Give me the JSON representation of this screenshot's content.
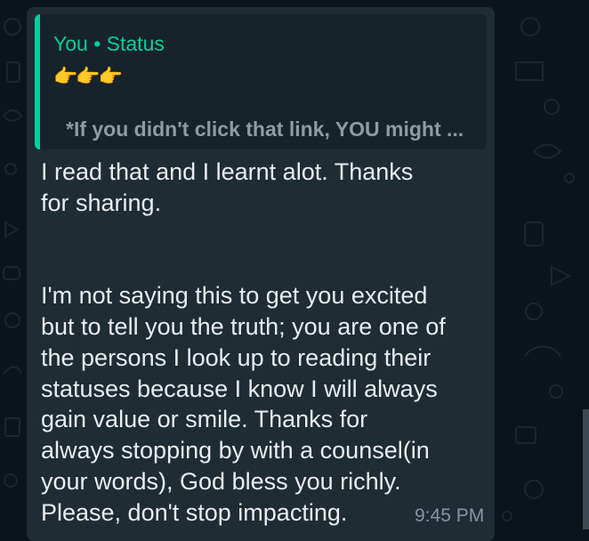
{
  "quote": {
    "author": "You",
    "separator": "•",
    "source": "Status",
    "emoji": "👉👉👉",
    "text": "*If you didn't click that link, YOU might ..."
  },
  "message": {
    "text": "I read that and I learnt alot. Thanks\nfor sharing.\n\n\nI'm not saying this to get you excited\nbut to tell you the truth; you are one of\nthe persons I look up to reading their\nstatuses because I know I will always\ngain value or smile. Thanks for\nalways stopping by with a counsel(in\nyour words), God bless you richly.\nPlease, don't stop impacting.",
    "time": "9:45 PM"
  },
  "colors": {
    "background": "#0b141a",
    "bubble": "#1f2c34",
    "quote_bg": "#17232a",
    "accent": "#06cf9c",
    "text": "#e9edef",
    "meta": "#8696a0"
  }
}
